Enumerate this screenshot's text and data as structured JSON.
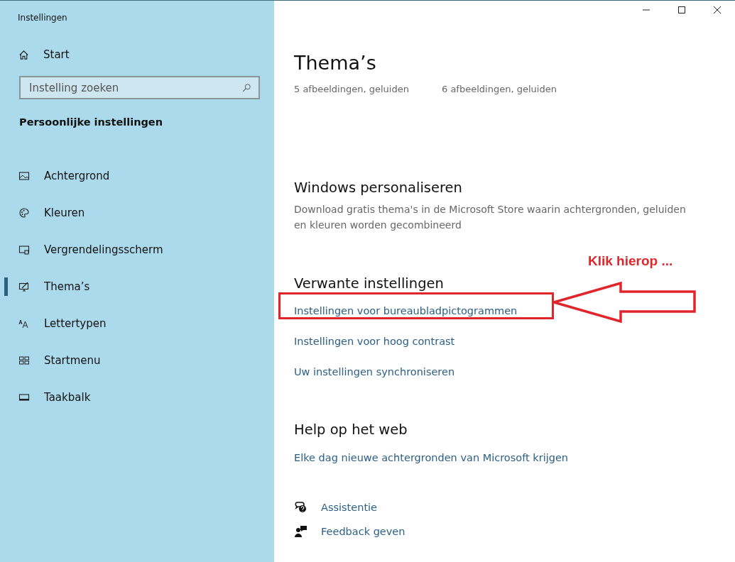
{
  "window": {
    "title": "Instellingen"
  },
  "sidebar": {
    "home": "Start",
    "search": {
      "placeholder": "Instelling zoeken"
    },
    "section": "Persoonlijke instellingen",
    "items": [
      {
        "label": "Achtergrond",
        "kind": "picture",
        "selected": false
      },
      {
        "label": "Kleuren",
        "kind": "palette",
        "selected": false
      },
      {
        "label": "Vergrendelingsscherm",
        "kind": "lockscreen",
        "selected": false
      },
      {
        "label": "Thema’s",
        "kind": "theme",
        "selected": true
      },
      {
        "label": "Lettertypen",
        "kind": "font",
        "selected": false
      },
      {
        "label": "Startmenu",
        "kind": "tiles",
        "selected": false
      },
      {
        "label": "Taakbalk",
        "kind": "taskbar",
        "selected": false
      }
    ]
  },
  "main": {
    "title": "Thema’s",
    "themes": [
      {
        "detail": "5 afbeeldingen, geluiden"
      },
      {
        "detail": "6 afbeeldingen, geluiden"
      }
    ],
    "personalize": {
      "heading": "Windows personaliseren",
      "text": "Download gratis thema's in de Microsoft Store waarin achtergronden, geluiden en kleuren worden gecombineerd"
    },
    "related": {
      "heading": "Verwante instellingen",
      "links": [
        {
          "label": "Instellingen voor bureaubladpictogrammen",
          "highlighted": true
        },
        {
          "label": "Instellingen voor hoog contrast",
          "highlighted": false
        },
        {
          "label": "Uw instellingen synchroniseren",
          "highlighted": false
        }
      ]
    },
    "help": {
      "heading": "Help op het web",
      "links": [
        "Elke dag nieuwe achtergronden van Microsoft krijgen"
      ]
    },
    "support": [
      {
        "label": "Assistentie",
        "kind": "help"
      },
      {
        "label": "Feedback geven",
        "kind": "feedback"
      }
    ]
  },
  "annotation": {
    "text": "Klik hierop ..."
  }
}
